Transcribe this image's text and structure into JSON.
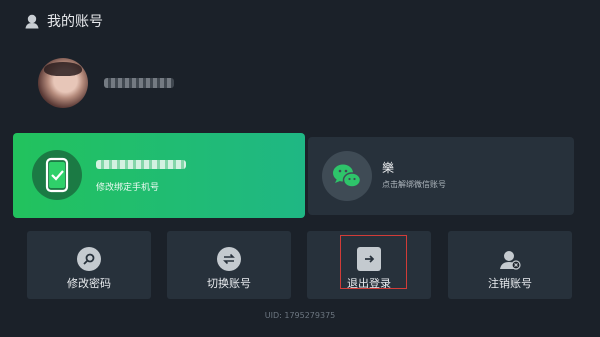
{
  "header": {
    "title": "我的账号",
    "icon": "account-icon"
  },
  "profile": {
    "avatar": "avatar-photo"
  },
  "phone_card": {
    "subtitle": "修改绑定手机号",
    "icon": "phone-check-icon",
    "color": "#22c25d"
  },
  "wechat_card": {
    "name": "樂",
    "subtitle": "点击解绑微信账号",
    "icon": "wechat-icon"
  },
  "actions": [
    {
      "label": "修改密码",
      "icon": "key-icon"
    },
    {
      "label": "切换账号",
      "icon": "switch-arrows-icon"
    },
    {
      "label": "退出登录",
      "icon": "logout-icon"
    },
    {
      "label": "注销账号",
      "icon": "cancel-account-icon"
    }
  ],
  "footer": {
    "uid": "UID: 1795279375"
  },
  "colors": {
    "background": "#1b2129",
    "card": "#27313b",
    "highlight": "#d13c38"
  }
}
